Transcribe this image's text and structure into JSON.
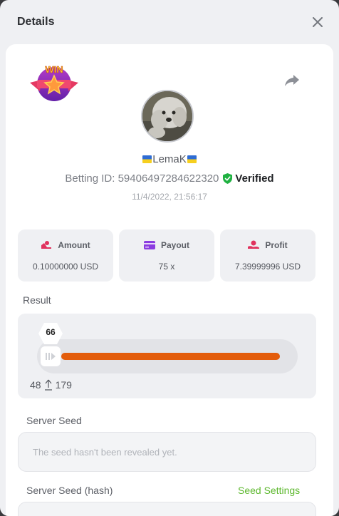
{
  "modal": {
    "title": "Details"
  },
  "profile": {
    "badge_text": "WIN",
    "username": "LemaK",
    "betting_id_label": "Betting ID: 59406497284622320",
    "verified_label": "Verified",
    "timestamp": "11/4/2022, 21:56:17"
  },
  "stats": {
    "amount": {
      "label": "Amount",
      "value": "0.10000000 USD"
    },
    "payout": {
      "label": "Payout",
      "value": "75 x"
    },
    "profit": {
      "label": "Profit",
      "value": "7.39999996 USD"
    }
  },
  "result": {
    "label": "Result",
    "value": "66",
    "progress_fraction": 0.985,
    "range_low": "48",
    "range_high": "179"
  },
  "server_seed": {
    "label": "Server Seed",
    "placeholder": "The seed hasn't been revealed yet."
  },
  "server_seed_hash": {
    "label": "Server Seed (hash)",
    "settings_link": "Seed Settings"
  },
  "colors": {
    "accent_orange": "#e35c0b",
    "verified_green": "#1fb141",
    "link_green": "#5db82e",
    "amount_icon": "#e0325d",
    "payout_icon": "#8b3de0",
    "profit_icon": "#e0325d"
  }
}
